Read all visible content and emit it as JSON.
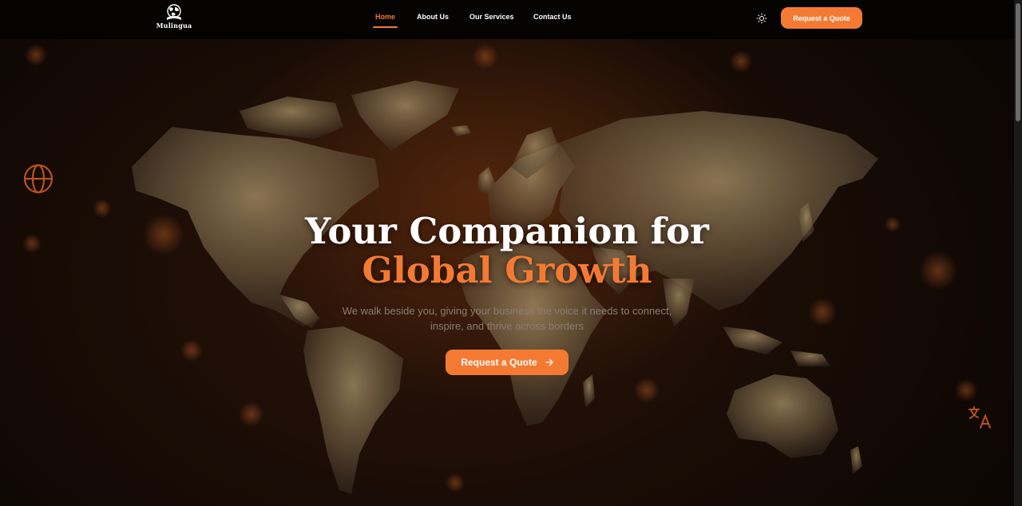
{
  "brand": {
    "name": "Mulingua",
    "icon": "globe-book-logo"
  },
  "nav": {
    "items": [
      {
        "label": "Home",
        "active": true
      },
      {
        "label": "About Us",
        "active": false
      },
      {
        "label": "Our Services",
        "active": false
      },
      {
        "label": "Contact Us",
        "active": false
      }
    ],
    "theme_icon": "sun-icon",
    "cta_label": "Request a Quote"
  },
  "hero": {
    "title_line1": "Your Companion for",
    "title_line2": "Global Growth",
    "subtitle_line1": "We walk beside you, giving your business the voice it needs to connect,",
    "subtitle_line2": "inspire, and thrive across borders",
    "cta_label": "Request a Quote",
    "cta_icon": "arrow-right-icon",
    "decor_icons": [
      "globe-icon",
      "translate-icon"
    ]
  },
  "colors": {
    "accent": "#f47a33",
    "nav_bg": "#050302",
    "hero_text": "#ffffff",
    "subtitle": "#8c7c70"
  }
}
